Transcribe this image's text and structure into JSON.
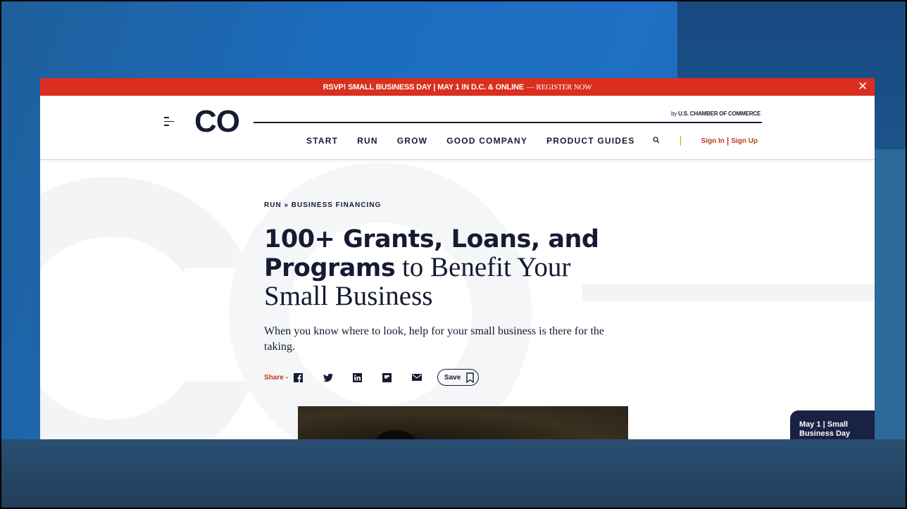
{
  "promo_bar": {
    "text": "RSVP! SMALL BUSINESS DAY | MAY 1 IN D.C. & ONLINE",
    "cta": "— REGISTER NOW",
    "close": "✕"
  },
  "header": {
    "logo": "CO",
    "byline_prefix": "by ",
    "byline_org": "U.S. CHAMBER OF COMMERCE",
    "nav": [
      "START",
      "RUN",
      "GROW",
      "GOOD COMPANY",
      "PRODUCT GUIDES"
    ],
    "sign_in": "Sign In",
    "auth_sep": "|",
    "sign_up": "Sign Up"
  },
  "article": {
    "breadcrumb": "RUN » BUSINESS FINANCING",
    "headline_bold_1": "100+ Grants, Loans, and",
    "headline_bold_2": "Programs",
    "headline_serif_2": " to Benefit Your",
    "headline_serif_3": "Small Business",
    "dek": "When you know where to look, help for your small business is there for the taking.",
    "share_label": "Share -",
    "save_label": "Save"
  },
  "side_promo": {
    "line1": "May 1 | Small",
    "line2": "Business Day"
  },
  "colors": {
    "promo_red": "#da2e1f",
    "navy": "#161b33",
    "accent_red": "#c0391f"
  }
}
